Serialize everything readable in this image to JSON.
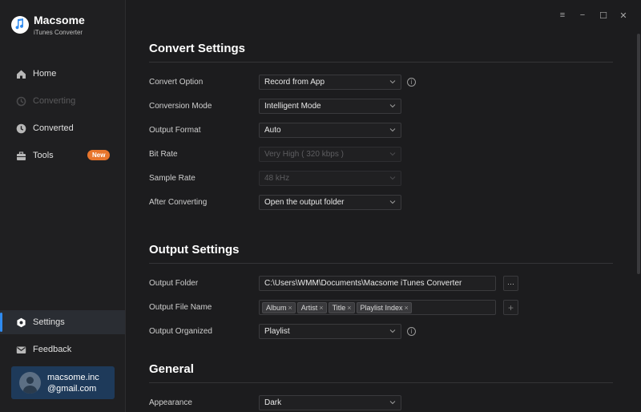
{
  "app": {
    "name": "Macsome",
    "subtitle": "iTunes Converter"
  },
  "sidebar": {
    "items": [
      {
        "label": "Home",
        "icon": "home-icon",
        "state": "normal"
      },
      {
        "label": "Converting",
        "icon": "converting-icon",
        "state": "disabled"
      },
      {
        "label": "Converted",
        "icon": "clock-icon",
        "state": "normal"
      },
      {
        "label": "Tools",
        "icon": "toolbox-icon",
        "state": "normal",
        "badge": "New"
      },
      {
        "label": "Settings",
        "icon": "settings-icon",
        "state": "active"
      },
      {
        "label": "Feedback",
        "icon": "mail-icon",
        "state": "normal"
      }
    ],
    "account": {
      "line1": "macsome.inc",
      "line2": "@gmail.com"
    }
  },
  "window": {
    "menu_icon": "≡",
    "minimize_icon": "−",
    "maximize_icon": "☐",
    "close_icon": "✕"
  },
  "convert_settings": {
    "title": "Convert Settings",
    "convert_option": {
      "label": "Convert Option",
      "value": "Record from App"
    },
    "conversion_mode": {
      "label": "Conversion Mode",
      "value": "Intelligent Mode"
    },
    "output_format": {
      "label": "Output Format",
      "value": "Auto"
    },
    "bit_rate": {
      "label": "Bit Rate",
      "value": "Very High ( 320 kbps )"
    },
    "sample_rate": {
      "label": "Sample Rate",
      "value": "48 kHz"
    },
    "after_converting": {
      "label": "After Converting",
      "value": "Open the output folder"
    }
  },
  "output_settings": {
    "title": "Output Settings",
    "output_folder": {
      "label": "Output Folder",
      "value": "C:\\Users\\WMM\\Documents\\Macsome iTunes Converter",
      "browse": "···"
    },
    "output_file_name": {
      "label": "Output File Name",
      "tags": [
        "Album",
        "Artist",
        "Title",
        "Playlist Index"
      ],
      "add": "+",
      "remove": "×"
    },
    "output_organized": {
      "label": "Output Organized",
      "value": "Playlist"
    }
  },
  "general": {
    "title": "General",
    "appearance": {
      "label": "Appearance",
      "value": "Dark"
    }
  },
  "info_glyph": "i",
  "colors": {
    "accent": "#2f8bf0",
    "badge": "#e8752c",
    "account_bg": "#1e3a5a",
    "background": "#1c1c1e"
  }
}
